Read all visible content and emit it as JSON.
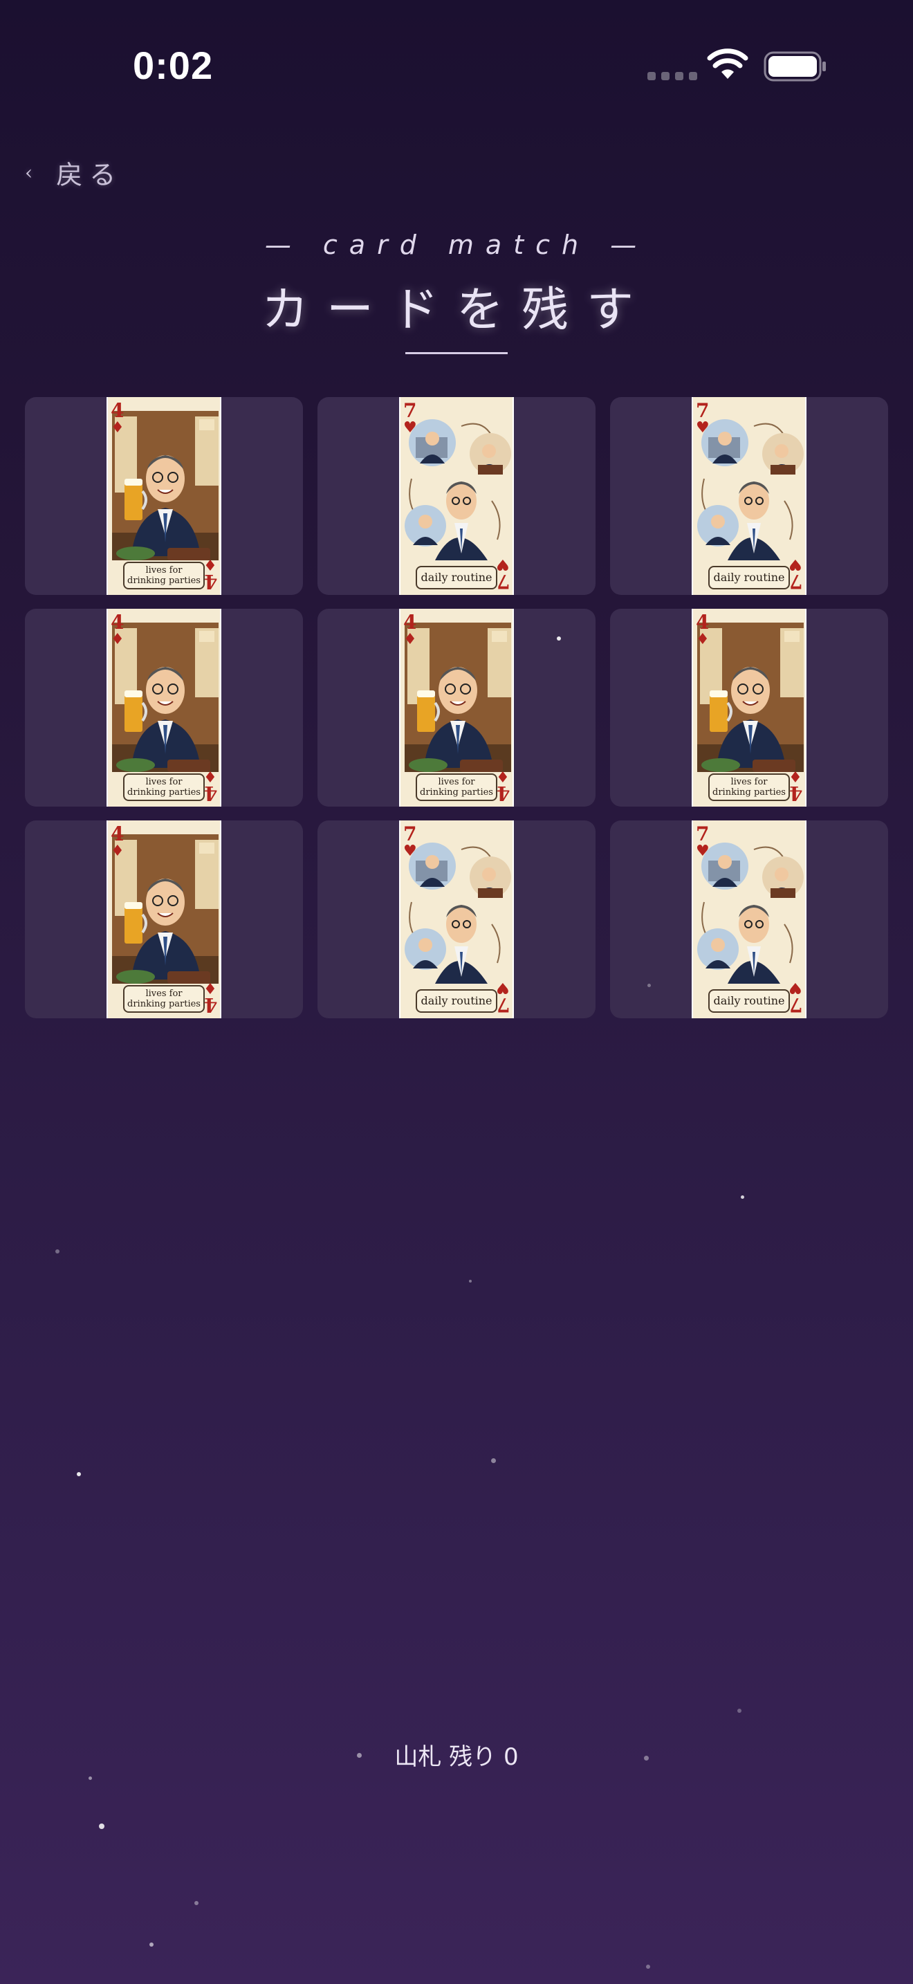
{
  "status_bar": {
    "time": "0:02"
  },
  "nav": {
    "back_chevron": "‹",
    "back_label": "戻る"
  },
  "header": {
    "subtitle": "— card match —",
    "title": "カードを残す"
  },
  "cards": [
    {
      "rank": "4",
      "suit": "♦",
      "caption": "lives for drinking parties",
      "art": "beer-salaryman"
    },
    {
      "rank": "7",
      "suit": "♥",
      "caption": "daily routine",
      "art": "routine-salaryman"
    },
    {
      "rank": "7",
      "suit": "♥",
      "caption": "daily routine",
      "art": "routine-salaryman"
    },
    {
      "rank": "4",
      "suit": "♦",
      "caption": "lives for drinking parties",
      "art": "beer-salaryman"
    },
    {
      "rank": "4",
      "suit": "♦",
      "caption": "lives for drinking parties",
      "art": "beer-salaryman"
    },
    {
      "rank": "4",
      "suit": "♦",
      "caption": "lives for drinking parties",
      "art": "beer-salaryman"
    },
    {
      "rank": "4",
      "suit": "♦",
      "caption": "lives for drinking parties",
      "art": "beer-salaryman"
    },
    {
      "rank": "7",
      "suit": "♥",
      "caption": "daily routine",
      "art": "routine-salaryman"
    },
    {
      "rank": "7",
      "suit": "♥",
      "caption": "daily routine",
      "art": "routine-salaryman"
    }
  ],
  "footer": {
    "deck_remaining": "山札 残り 0"
  },
  "colors": {
    "suit_red": "#b3231d",
    "slot_bg": "#3a2c4f"
  }
}
